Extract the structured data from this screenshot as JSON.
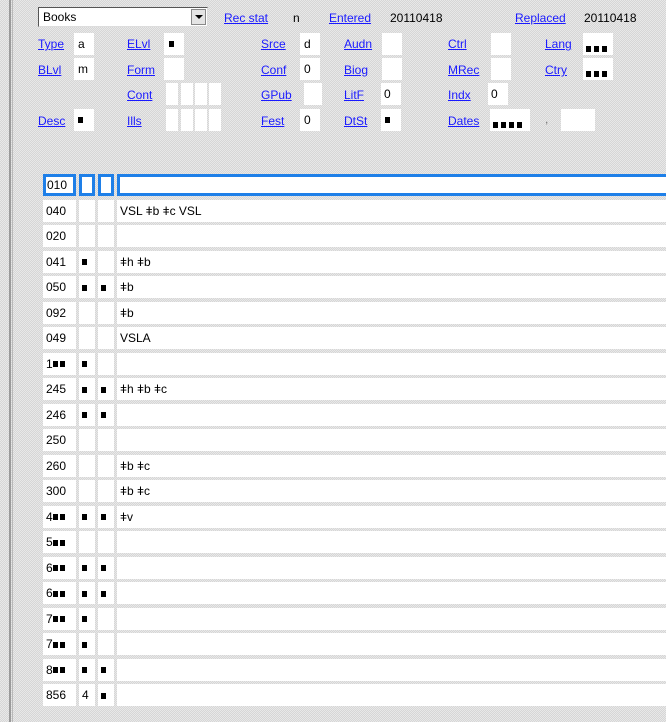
{
  "header": {
    "format_select": {
      "value": "Books"
    },
    "rec_stat": {
      "label": "Rec stat",
      "value": "n"
    },
    "entered": {
      "label": "Entered",
      "value": "20110418"
    },
    "replaced": {
      "label": "Replaced",
      "value": "20110418"
    }
  },
  "fixed_fields": {
    "type": {
      "label": "Type",
      "value": "a"
    },
    "elvl": {
      "label": "ELvl",
      "value": "■"
    },
    "srce": {
      "label": "Srce",
      "value": "d"
    },
    "audn": {
      "label": "Audn",
      "value": ""
    },
    "ctrl": {
      "label": "Ctrl",
      "value": ""
    },
    "lang": {
      "label": "Lang",
      "value": "■■■"
    },
    "blvl": {
      "label": "BLvl",
      "value": "m"
    },
    "form": {
      "label": "Form",
      "value": ""
    },
    "conf": {
      "label": "Conf",
      "value": "0"
    },
    "biog": {
      "label": "Biog",
      "value": ""
    },
    "mrec": {
      "label": "MRec",
      "value": ""
    },
    "ctry": {
      "label": "Ctry",
      "value": "■■■"
    },
    "cont": {
      "label": "Cont",
      "value": ""
    },
    "gpub": {
      "label": "GPub",
      "value": ""
    },
    "litf": {
      "label": "LitF",
      "value": "0"
    },
    "indx": {
      "label": "Indx",
      "value": "0"
    },
    "desc": {
      "label": "Desc",
      "value": "■"
    },
    "ills": {
      "label": "Ills",
      "value": ""
    },
    "fest": {
      "label": "Fest",
      "value": "0"
    },
    "dtst": {
      "label": "DtSt",
      "value": "■"
    },
    "dates": {
      "label": "Dates",
      "value": "■■■■",
      "separator": ",",
      "value2": ""
    }
  },
  "variable_fields": [
    {
      "tag": "010",
      "ind1": "",
      "ind2": "",
      "data": "",
      "selected": true
    },
    {
      "tag": "040",
      "ind1": "",
      "ind2": "",
      "data": "VSL ǂb ǂc VSL"
    },
    {
      "tag": "020",
      "ind1": "",
      "ind2": "",
      "data": ""
    },
    {
      "tag": "041",
      "ind1": "■",
      "ind2": "",
      "data": " ǂh ǂb"
    },
    {
      "tag": "050",
      "ind1": "■",
      "ind2": "■",
      "data": " ǂb"
    },
    {
      "tag": "092",
      "ind1": "",
      "ind2": "",
      "data": " ǂb"
    },
    {
      "tag": "049",
      "ind1": "",
      "ind2": "",
      "data": "VSLA"
    },
    {
      "tag": "1■■",
      "ind1": "■",
      "ind2": "",
      "data": ""
    },
    {
      "tag": "245",
      "ind1": "■",
      "ind2": "■",
      "data": " ǂh ǂb ǂc"
    },
    {
      "tag": "246",
      "ind1": "■",
      "ind2": "■",
      "data": ""
    },
    {
      "tag": "250",
      "ind1": "",
      "ind2": "",
      "data": ""
    },
    {
      "tag": "260",
      "ind1": "",
      "ind2": "",
      "data": " ǂb ǂc"
    },
    {
      "tag": "300",
      "ind1": "",
      "ind2": "",
      "data": " ǂb ǂc"
    },
    {
      "tag": "4■■",
      "ind1": "■",
      "ind2": "■",
      "data": " ǂv"
    },
    {
      "tag": "5■■",
      "ind1": "",
      "ind2": "",
      "data": ""
    },
    {
      "tag": "6■■",
      "ind1": "■",
      "ind2": "■",
      "data": ""
    },
    {
      "tag": "6■■",
      "ind1": "■",
      "ind2": "■",
      "data": ""
    },
    {
      "tag": "7■■",
      "ind1": "■",
      "ind2": "",
      "data": ""
    },
    {
      "tag": "7■■",
      "ind1": "■",
      "ind2": "",
      "data": ""
    },
    {
      "tag": "8■■",
      "ind1": "■",
      "ind2": "■",
      "data": ""
    },
    {
      "tag": "856",
      "ind1": "4",
      "ind2": "■",
      "data": ""
    }
  ],
  "colors": {
    "link": "#1a1aff",
    "selection": "#1e7fe8"
  }
}
